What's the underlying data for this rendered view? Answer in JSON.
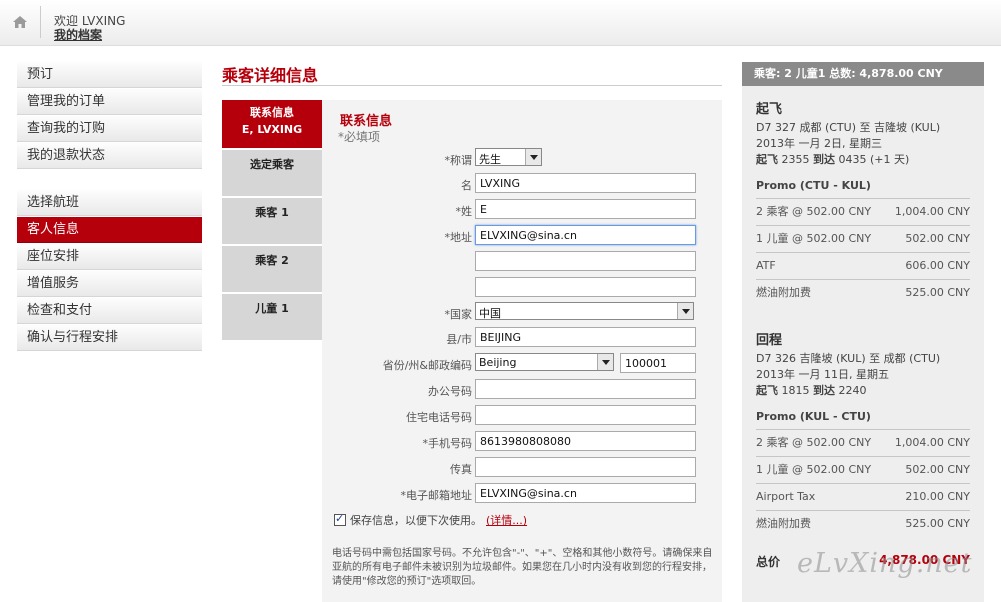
{
  "header": {
    "welcome": "欢迎 LVXING",
    "profile_link": "我的档案"
  },
  "nav": {
    "group1": [
      "预订",
      "管理我的订单",
      "查询我的订购",
      "我的退款状态"
    ],
    "group2": [
      "选择航班",
      "客人信息",
      "座位安排",
      "增值服务",
      "检查和支付",
      "确认与行程安排"
    ],
    "active": "客人信息"
  },
  "page_title": "乘客详细信息",
  "steps": {
    "active_label": "联系信息",
    "active_sub": "E, LVXING",
    "items": [
      "选定乘客",
      "乘客 1",
      "乘客 2",
      "儿童 1"
    ]
  },
  "contact": {
    "section_title": "联系信息",
    "required_note": "*必填项",
    "salutation_label": "*称谓",
    "salutation_value": "先生",
    "first_name_label": "名",
    "first_name_value": "LVXING",
    "last_name_label": "*姓",
    "last_name_value": "E",
    "address_label": "*地址",
    "address_value": "ELVXING@sina.cn",
    "address2_value": "",
    "address3_value": "",
    "country_label": "*国家",
    "country_value": "中国",
    "city_label": "县/市",
    "city_value": "BEIJING",
    "province_label": "省份/州&邮政编码",
    "province_value": "Beijing",
    "postal_value": "100001",
    "office_phone_label": "办公号码",
    "office_phone_value": "",
    "home_phone_label": "住宅电话号码",
    "home_phone_value": "",
    "mobile_label": "*手机号码",
    "mobile_value": "8613980808080",
    "fax_label": "传真",
    "fax_value": "",
    "email_label": "*电子邮箱地址",
    "email_value": "ELVXING@sina.cn",
    "save_info": "保存信息，以便下次使用。",
    "more_link": "(详情...)",
    "note": "电话号码中需包括国家号码。不允许包含\"-\"、\"+\"、空格和其他小数符号。请确保来自亚航的所有电子邮件未被识别为垃圾邮件。如果您在几小时内没有收到您的行程安排，请使用\"修改您的预订\"选项取回。"
  },
  "summary": {
    "header": "乘客: 2 儿童1 总数: 4,878.00 CNY",
    "depart": {
      "title": "起飞",
      "flight": "D7 327 成都 (CTU) 至 吉隆坡 (KUL)",
      "date": "2013年 一月 2日, 星期三",
      "times_dep_label": "起飞",
      "times_dep": "2355",
      "times_arr_label": "到达",
      "times_arr": "0435 (+1 天)",
      "fare_title": "Promo (CTU - KUL)",
      "rows": [
        {
          "label": "2 乘客 @ 502.00 CNY",
          "amount": "1,004.00 CNY"
        },
        {
          "label": "1 儿童 @ 502.00 CNY",
          "amount": "502.00 CNY"
        },
        {
          "label": "ATF",
          "amount": "606.00 CNY"
        },
        {
          "label": "燃油附加费",
          "amount": "525.00 CNY"
        }
      ]
    },
    "return": {
      "title": "回程",
      "flight": "D7 326 吉隆坡 (KUL) 至 成都 (CTU)",
      "date": "2013年 一月 11日, 星期五",
      "times_dep_label": "起飞",
      "times_dep": "1815",
      "times_arr_label": "到达",
      "times_arr": "2240",
      "fare_title": "Promo (KUL - CTU)",
      "rows": [
        {
          "label": "2 乘客 @ 502.00 CNY",
          "amount": "1,004.00 CNY"
        },
        {
          "label": "1 儿童 @ 502.00 CNY",
          "amount": "502.00 CNY"
        },
        {
          "label": "Airport Tax",
          "amount": "210.00 CNY"
        },
        {
          "label": "燃油附加费",
          "amount": "525.00 CNY"
        }
      ]
    },
    "total_label": "总价",
    "total_amount": "4,878.00 CNY"
  },
  "watermark": "eLvXing.net",
  "colors": {
    "brand_red": "#b5000c",
    "summary_header": "#8a8a8a",
    "panel_bg": "#f3f3f3"
  }
}
